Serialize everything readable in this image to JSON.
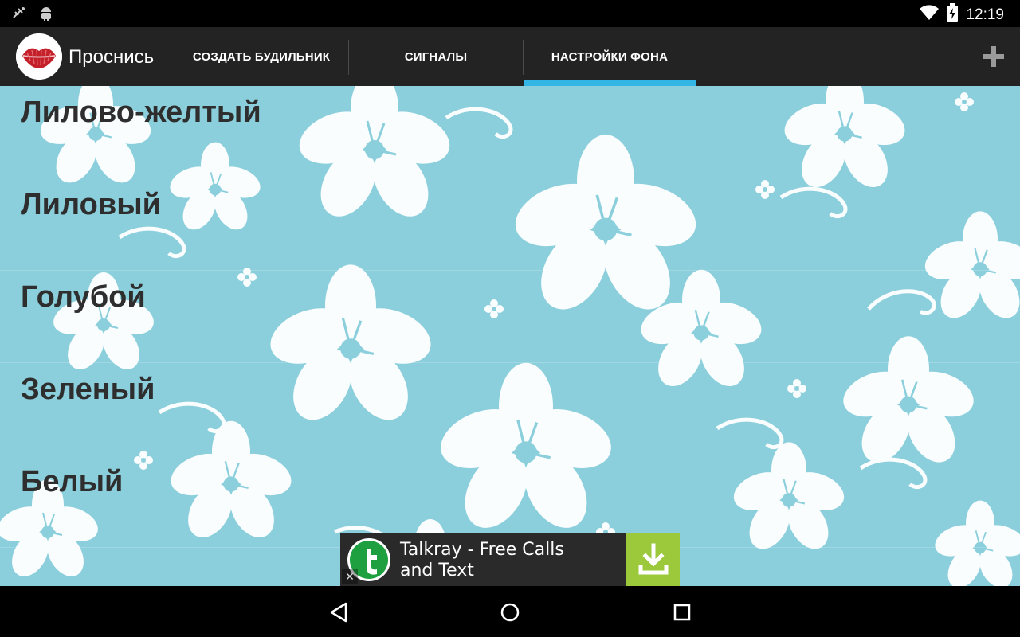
{
  "status_bar": {
    "time": "12:19",
    "icons": [
      "usb-debug-icon",
      "android-icon",
      "wifi-icon",
      "battery-charging-icon"
    ]
  },
  "action_bar": {
    "app_title": "Проснись",
    "app_icon": "lips-icon",
    "tabs": [
      {
        "label": "СОЗДАТЬ БУДИЛЬНИК",
        "selected": false
      },
      {
        "label": "СИГНАЛЫ",
        "selected": false
      },
      {
        "label": "НАСТРОЙКИ ФОНА",
        "selected": true
      }
    ],
    "add_icon": "plus-icon",
    "accent_color": "#33b5e5"
  },
  "background_list": {
    "items": [
      {
        "label": "Лилово-желтый"
      },
      {
        "label": "Лиловый"
      },
      {
        "label": "Голубой"
      },
      {
        "label": "Зеленый"
      },
      {
        "label": "Белый"
      }
    ]
  },
  "ad": {
    "text": "Talkray - Free Calls and Text",
    "icon": "talkray-icon",
    "download_icon": "download-icon",
    "close_icon": "close-icon",
    "download_color": "#9bc93b"
  },
  "nav_bar": {
    "icons": [
      "back-icon",
      "home-icon",
      "recent-apps-icon"
    ]
  }
}
